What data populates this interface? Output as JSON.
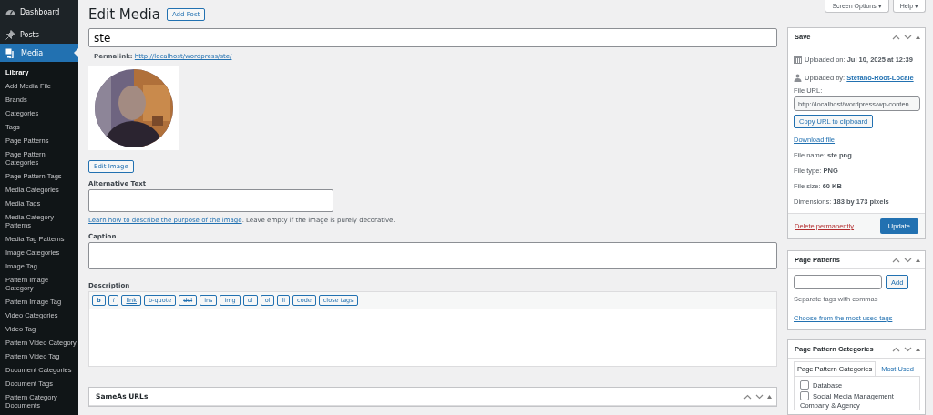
{
  "sidebar": {
    "menu": [
      {
        "label": "Dashboard",
        "kind": "dashboard",
        "selected": false
      },
      {
        "label": "Posts",
        "kind": "posts",
        "selected": false
      },
      {
        "label": "Media",
        "kind": "media",
        "selected": true
      }
    ],
    "submenu": [
      {
        "label": "Library",
        "selected": true
      },
      {
        "label": "Add Media File",
        "selected": false
      },
      {
        "label": "Brands",
        "selected": false
      },
      {
        "label": "Categories",
        "selected": false
      },
      {
        "label": "Tags",
        "selected": false
      },
      {
        "label": "Page Patterns",
        "selected": false
      },
      {
        "label": "Page Pattern Categories",
        "selected": false
      },
      {
        "label": "Page Pattern Tags",
        "selected": false
      },
      {
        "label": "Media Categories",
        "selected": false
      },
      {
        "label": "Media Tags",
        "selected": false
      },
      {
        "label": "Media Category Patterns",
        "selected": false
      },
      {
        "label": "Media Tag Patterns",
        "selected": false
      },
      {
        "label": "Image Categories",
        "selected": false
      },
      {
        "label": "Image Tag",
        "selected": false
      },
      {
        "label": "Pattern Image Category",
        "selected": false
      },
      {
        "label": "Pattern Image Tag",
        "selected": false
      },
      {
        "label": "Video Categories",
        "selected": false
      },
      {
        "label": "Video Tag",
        "selected": false
      },
      {
        "label": "Pattern Video Category",
        "selected": false
      },
      {
        "label": "Pattern Video Tag",
        "selected": false
      },
      {
        "label": "Document Categories",
        "selected": false
      },
      {
        "label": "Document Tags",
        "selected": false
      },
      {
        "label": "Pattern Category Documents",
        "selected": false
      }
    ]
  },
  "header": {
    "title": "Edit Media",
    "add_button": "Add Post",
    "screen_options": "Screen Options ▾",
    "help": "Help ▾"
  },
  "title_field": {
    "value": "ste"
  },
  "permalink": {
    "label": "Permalink:",
    "url": "http://localhost/wordpress/ste/"
  },
  "edit_image_button": "Edit Image",
  "alt_text": {
    "label": "Alternative Text",
    "help_link": "Learn how to describe the purpose of the image",
    "help_text": ". Leave empty if the image is purely decorative."
  },
  "caption": {
    "label": "Caption"
  },
  "description": {
    "label": "Description",
    "toolbar": [
      {
        "label": "b",
        "kind": "bold"
      },
      {
        "label": "i",
        "kind": "italic"
      },
      {
        "label": "link",
        "kind": "underline"
      },
      {
        "label": "b-quote",
        "kind": "plain"
      },
      {
        "label": "del",
        "kind": "strike"
      },
      {
        "label": "ins",
        "kind": "plain"
      },
      {
        "label": "img",
        "kind": "plain"
      },
      {
        "label": "ul",
        "kind": "plain"
      },
      {
        "label": "ol",
        "kind": "plain"
      },
      {
        "label": "li",
        "kind": "plain"
      },
      {
        "label": "code",
        "kind": "plain"
      },
      {
        "label": "close tags",
        "kind": "plain"
      }
    ]
  },
  "sameas_box": {
    "title": "SameAs URLs"
  },
  "save_box": {
    "title": "Save",
    "uploaded_on": {
      "label": "Uploaded on:",
      "value": "Jul 10, 2025 at 12:39"
    },
    "uploaded_by": {
      "label": "Uploaded by:",
      "value": "Stefano-Root-Locale"
    },
    "file_url": {
      "label": "File URL:",
      "value": "http://localhost/wordpress/wp-conten"
    },
    "copy_button": "Copy URL to clipboard",
    "download_link": "Download file",
    "details": [
      {
        "label": "File name:",
        "value": "ste.png"
      },
      {
        "label": "File type:",
        "value": "PNG"
      },
      {
        "label": "File size:",
        "value": "60 KB"
      },
      {
        "label": "Dimensions:",
        "value": "183 by 173 pixels"
      }
    ],
    "delete_link": "Delete permanently",
    "update_button": "Update"
  },
  "page_patterns_box": {
    "title": "Page Patterns",
    "add_button": "Add",
    "hint": "Separate tags with commas",
    "choose_link": "Choose from the most used tags"
  },
  "categories_box": {
    "title": "Page Pattern Categories",
    "tabs": [
      {
        "label": "Page Pattern Categories",
        "selected": true
      },
      {
        "label": "Most Used",
        "selected": false
      }
    ],
    "items": [
      {
        "kind": "checkbox",
        "label": "Database",
        "checked": false
      },
      {
        "kind": "checkbox",
        "label": "Social Media Management",
        "checked": false
      },
      {
        "kind": "heading",
        "label": "Company & Agency"
      }
    ]
  }
}
